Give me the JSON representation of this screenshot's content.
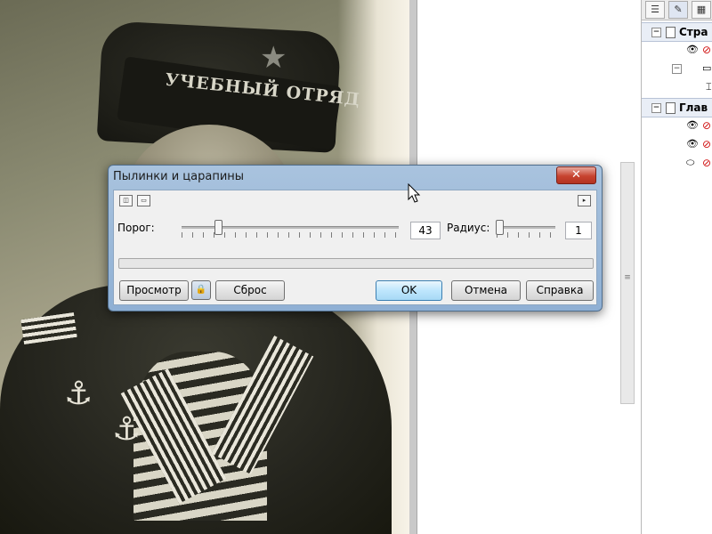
{
  "photo": {
    "cap_text": "УЧЕБНЫЙ ОТРЯД"
  },
  "dialog": {
    "title": "Пылинки и царапины",
    "close_glyph": "✕",
    "threshold_label": "Порог:",
    "threshold_value": "43",
    "radius_label": "Радиус:",
    "radius_value": "1",
    "threshold_slider_level": 0.17,
    "radius_slider_level": 0.05,
    "buttons": {
      "preview": "Просмотр",
      "reset": "Сброс",
      "ok": "OK",
      "cancel": "Отмена",
      "help": "Справка"
    }
  },
  "object_manager": {
    "rows": [
      {
        "label": "Стра",
        "type": "header"
      },
      {
        "label": "Глав",
        "type": "header"
      }
    ]
  },
  "icons": {
    "close": "close-icon",
    "lock": "lock-icon",
    "eye": "eye-icon",
    "no_print": "no-print-icon",
    "page": "page-icon",
    "expander": "expander-icon",
    "cursor": "mouse-cursor-icon"
  },
  "colors": {
    "dialog_frame": "#a9c3de",
    "close_button": "#c7432f",
    "default_button": "#bee6fd",
    "no_icon": "#d01010"
  }
}
